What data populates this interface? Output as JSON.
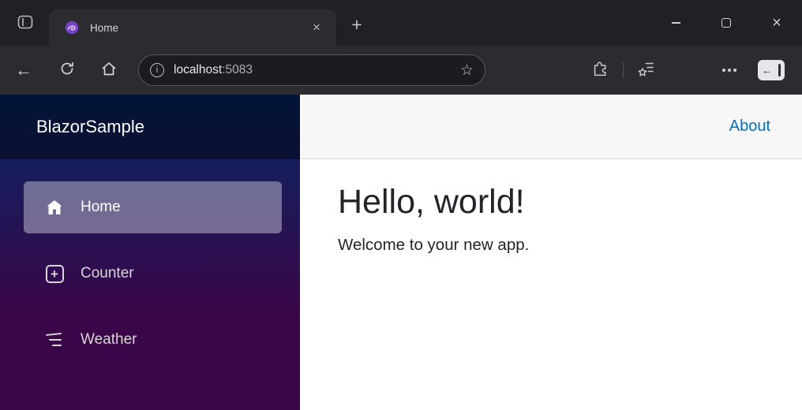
{
  "browser": {
    "tab": {
      "title": "Home"
    },
    "address": {
      "host": "localhost",
      "port": ":5083"
    }
  },
  "glyphs": {
    "back": "←",
    "plus": "+",
    "close": "×",
    "star": "☆",
    "info": "i",
    "sidebar_arrow": "←"
  },
  "app": {
    "brand": "BlazorSample",
    "nav": [
      {
        "label": "Home",
        "icon": "house-icon",
        "active": true
      },
      {
        "label": "Counter",
        "icon": "plus-square-icon",
        "active": false
      },
      {
        "label": "Weather",
        "icon": "list-nested-icon",
        "active": false
      }
    ],
    "about_label": "About",
    "heading": "Hello, world!",
    "welcome": "Welcome to your new app."
  },
  "colors": {
    "link": "#0071c1",
    "sidebar_gradient_top": "#052767",
    "sidebar_gradient_bottom": "#3a0647",
    "active_nav_item": "rgba(255,255,255,0.37)",
    "chrome_background": "#202124",
    "toolbar_background": "#2b2c30",
    "page_topbar_background": "#f7f7f7"
  }
}
